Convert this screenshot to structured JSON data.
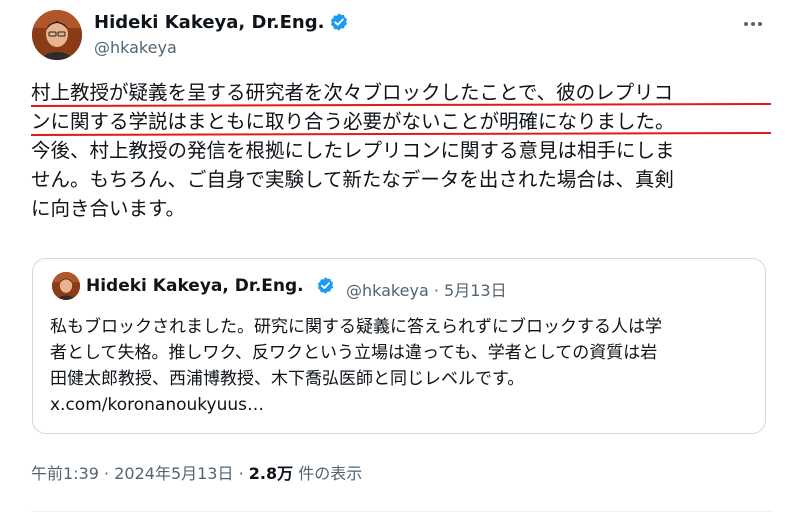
{
  "author": {
    "name": "Hideki Kakeya, Dr.Eng.",
    "handle": "@hkakeya"
  },
  "tweet": {
    "lines": [
      "村上教授が疑義を呈する研究者を次々ブロックしたことで、彼のレプリコ",
      "ンに関する学説はまともに取り合う必要がないことが明確になりました。",
      "今後、村上教授の発信を根拠にしたレプリコンに関する意見は相手にしま",
      "せん。もちろん、ご自身で実験して新たなデータを出された場合は、真剣",
      "に向き合います。"
    ]
  },
  "quote": {
    "name": "Hideki Kakeya, Dr.Eng.",
    "handle": "@hkakeya",
    "date": "5月13日",
    "separator": "·",
    "lines": [
      "私もブロックされました。研究に関する疑義に答えられずにブロックする人は学",
      "者として失格。推しワク、反ワクという立場は違っても、学者としての資質は岩",
      "田健太郎教授、西浦博教授、木下喬弘医師と同じレベルです。",
      "x.com/koronanoukyuus…"
    ]
  },
  "footer": {
    "time": "午前1:39",
    "sep": "·",
    "date": "2024年5月13日",
    "views_count": "2.8万",
    "views_label": " 件の表示"
  },
  "colors": {
    "underline": "#e01b1b",
    "verified": "#1d9bf0",
    "secondary": "#536471"
  },
  "icons": [
    "verified-badge-icon",
    "more-options-icon"
  ]
}
